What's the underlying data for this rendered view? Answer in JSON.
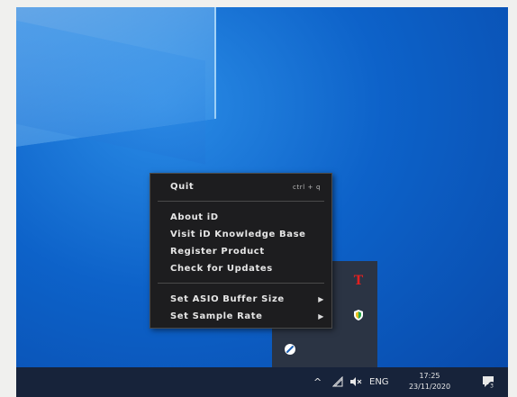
{
  "context_menu": {
    "quit": {
      "label": "Quit",
      "shortcut": "ctrl + q"
    },
    "about": "About iD",
    "knowledge_base": "Visit iD Knowledge Base",
    "register": "Register Product",
    "updates": "Check for Updates",
    "asio_buffer": "Set ASIO Buffer Size",
    "sample_rate": "Set Sample Rate"
  },
  "taskbar": {
    "language": "ENG",
    "time": "17:25",
    "date": "23/11/2020",
    "notification_count": "3"
  },
  "tray_icons": [
    "t-app-icon",
    "shield-icon",
    "wrench-icon"
  ]
}
